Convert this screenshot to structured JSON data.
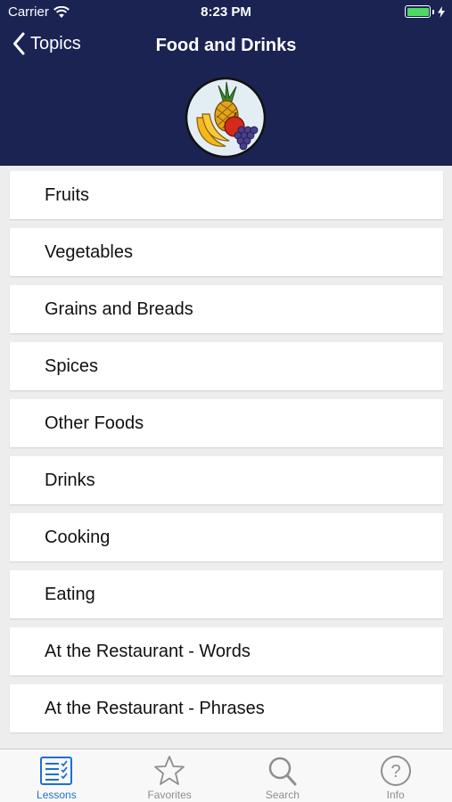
{
  "status_bar": {
    "carrier": "Carrier",
    "time": "8:23 PM"
  },
  "nav": {
    "back_label": "Topics",
    "title": "Food and Drinks"
  },
  "items": [
    {
      "label": "Fruits"
    },
    {
      "label": "Vegetables"
    },
    {
      "label": "Grains and Breads"
    },
    {
      "label": "Spices"
    },
    {
      "label": "Other Foods"
    },
    {
      "label": "Drinks"
    },
    {
      "label": "Cooking"
    },
    {
      "label": "Eating"
    },
    {
      "label": "At the Restaurant - Words"
    },
    {
      "label": "At the Restaurant - Phrases"
    }
  ],
  "tabs": [
    {
      "label": "Lessons",
      "icon": "lessons-icon",
      "active": true
    },
    {
      "label": "Favorites",
      "icon": "star-icon",
      "active": false
    },
    {
      "label": "Search",
      "icon": "search-icon",
      "active": false
    },
    {
      "label": "Info",
      "icon": "info-icon",
      "active": false
    }
  ],
  "colors": {
    "header": "#1b2353",
    "accent": "#1f6fd1",
    "battery": "#4cd964"
  }
}
